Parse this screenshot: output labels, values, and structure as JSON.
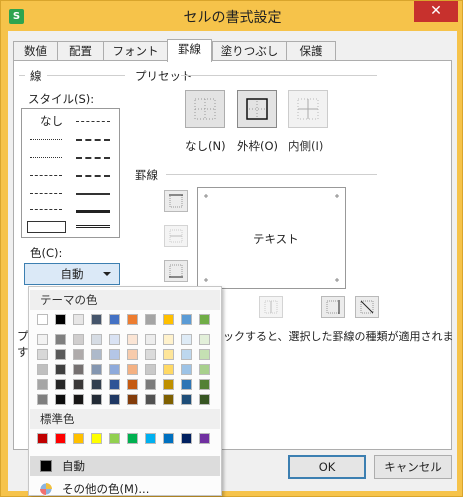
{
  "window": {
    "title": "セルの書式設定",
    "app_icon": "S",
    "close_glyph": "✕"
  },
  "tabs": [
    {
      "label": "数値"
    },
    {
      "label": "配置"
    },
    {
      "label": "フォント"
    },
    {
      "label": "罫線",
      "active": true
    },
    {
      "label": "塗りつぶし"
    },
    {
      "label": "保護"
    }
  ],
  "line": {
    "group_label": "線",
    "style_label": "スタイル(S):",
    "none_label": "なし",
    "color_label": "色(C):",
    "color_value": "自動"
  },
  "preset": {
    "group_label": "プリセット",
    "none_label": "なし(N)",
    "outline_label": "外枠(O)",
    "inside_label": "内側(I)"
  },
  "border": {
    "group_label": "罫線",
    "preview_text": "テキスト"
  },
  "hint_text": "ックすると、選択した罫線の種類が適用されま",
  "hint_prefix": "プ",
  "hint_prefix2": "す",
  "buttons": {
    "ok": "OK",
    "cancel": "キャンセル"
  },
  "color_dropdown": {
    "theme_header": "テーマの色",
    "standard_header": "標準色",
    "auto_label": "自動",
    "more_label": "その他の色(M)...",
    "theme_top": [
      "#ffffff",
      "#000000",
      "#e7e6e6",
      "#44546a",
      "#4472c4",
      "#ed7d31",
      "#a5a5a5",
      "#ffc000",
      "#5b9bd5",
      "#70ad47"
    ],
    "theme_shades": [
      [
        "#f2f2f2",
        "#7f7f7f",
        "#d0cece",
        "#d6dce4",
        "#d9e2f3",
        "#fbe5d5",
        "#ededed",
        "#fff2cc",
        "#deebf6",
        "#e2efd9"
      ],
      [
        "#d8d8d8",
        "#595959",
        "#aeaaaa",
        "#adb9ca",
        "#b4c6e7",
        "#f7cbac",
        "#dbdbdb",
        "#fee599",
        "#bdd7ee",
        "#c5e0b3"
      ],
      [
        "#bfbfbf",
        "#3f3f3f",
        "#757070",
        "#8496b0",
        "#8eaadb",
        "#f4b183",
        "#c9c9c9",
        "#ffd965",
        "#9dc3e6",
        "#a8d08d"
      ],
      [
        "#a5a5a5",
        "#262626",
        "#3a3838",
        "#323f4f",
        "#2f5496",
        "#c55a11",
        "#7b7b7b",
        "#bf9000",
        "#2e75b5",
        "#538135"
      ],
      [
        "#7f7f7f",
        "#0c0c0c",
        "#171616",
        "#222a35",
        "#1f3864",
        "#833c0b",
        "#525252",
        "#7f6000",
        "#1e4e79",
        "#375623"
      ]
    ],
    "standard": [
      "#c00000",
      "#ff0000",
      "#ffc000",
      "#ffff00",
      "#92d050",
      "#00b050",
      "#00b0f0",
      "#0070c0",
      "#002060",
      "#7030a0"
    ],
    "auto_swatch": "#000000"
  }
}
